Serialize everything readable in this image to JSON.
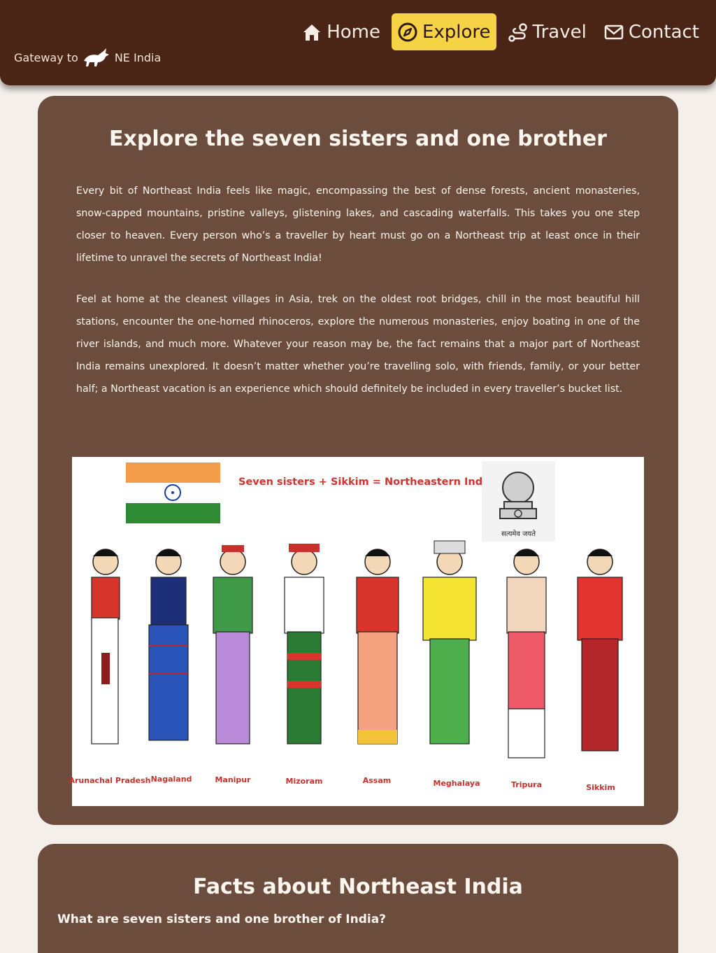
{
  "header": {
    "brand_prefix": "Gateway to",
    "brand_suffix": "NE India",
    "nav": [
      {
        "label": "Home",
        "icon": "home-icon"
      },
      {
        "label": "Explore",
        "icon": "compass-icon",
        "active": true
      },
      {
        "label": "Travel",
        "icon": "route-icon"
      },
      {
        "label": "Contact",
        "icon": "envelope-icon"
      }
    ]
  },
  "explore": {
    "title": "Explore the seven sisters and one brother",
    "paragraph1": "Every bit of Northeast India feels like magic, encompassing the best of dense forests, ancient monasteries, snow-capped mountains, pristine valleys, glistening lakes, and cascading waterfalls. This takes you one step closer to heaven. Every person who’s a traveller by heart must go on a Northeast trip at least once in their lifetime to unravel the secrets of Northeast India!",
    "paragraph2": "Feel at home at the cleanest villages in Asia, trek on the oldest root bridges, chill in the most beautiful hill stations, encounter the one-horned rhinoceros, explore the numerous monasteries, enjoy boating in one of the river islands, and much more. Whatever your reason may be, the fact remains that a major part of Northeast India remains unexplored. It doesn’t matter whether you’re travelling solo, with friends, family, or your better half; a Northeast vacation is an experience which should definitely be included in every traveller’s bucket list.",
    "illustration": {
      "banner": "Seven sisters + Sikkim = Northeastern India",
      "emblem_motto": "सत्यमेव जयते",
      "states": [
        "Arunachal Pradesh",
        "Nagaland",
        "Manipur",
        "Mizoram",
        "Assam",
        "Meghalaya",
        "Tripura",
        "Sikkim"
      ]
    }
  },
  "facts": {
    "title": "Facts about Northeast India",
    "question1": "What are seven sisters and one brother of India?"
  },
  "colors": {
    "header_bg": "#4a2415",
    "card_bg": "#6c4c3c",
    "active_nav": "#f6d245",
    "page_bg": "#f4efe9",
    "label_red": "#c8302b"
  }
}
